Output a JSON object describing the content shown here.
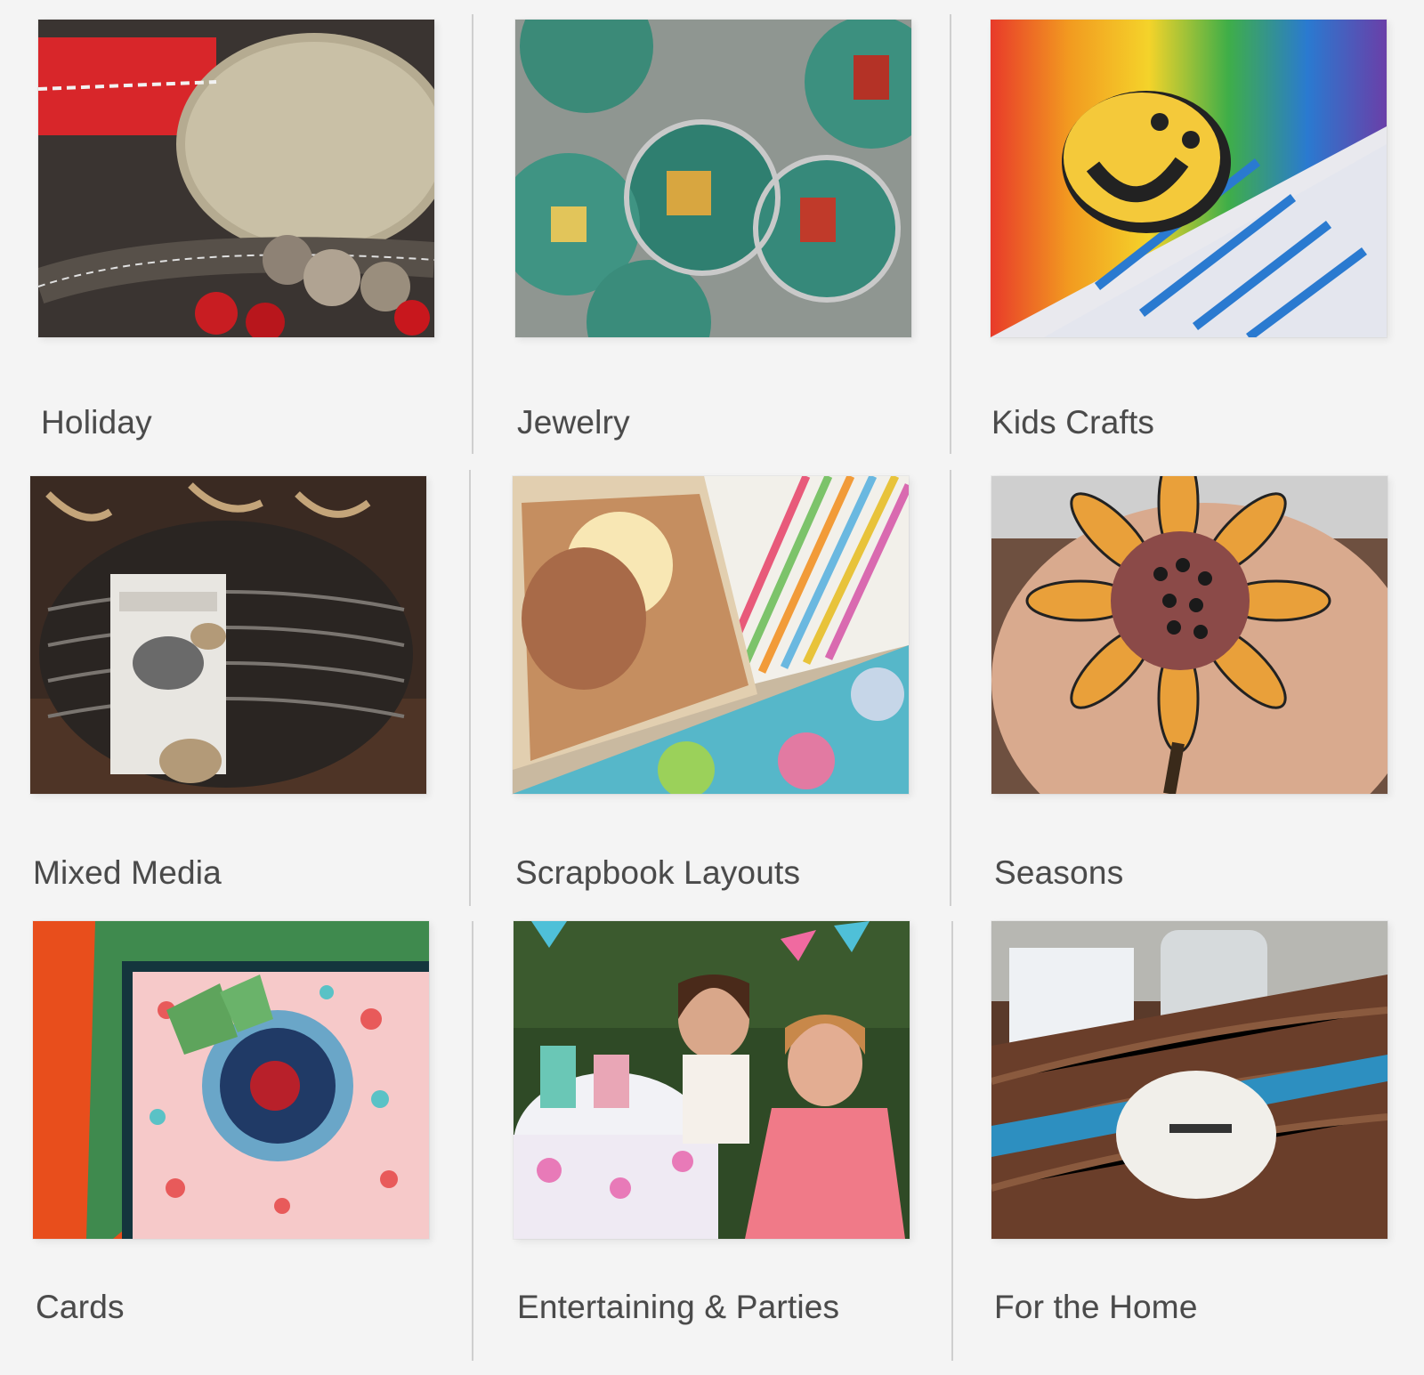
{
  "gallery": {
    "categories": [
      {
        "label": "Holiday",
        "photo": "gift-tag-photo"
      },
      {
        "label": "Jewelry",
        "photo": "bottlecap-necklace-photo"
      },
      {
        "label": "Kids Crafts",
        "photo": "melted-crayon-art-photo"
      },
      {
        "label": "Mixed Media",
        "photo": "basket-with-tags-photo"
      },
      {
        "label": "Scrapbook Layouts",
        "photo": "scrapbook-page-photo"
      },
      {
        "label": "Seasons",
        "photo": "sunflower-art-photo"
      },
      {
        "label": "Cards",
        "photo": "flower-card-photo"
      },
      {
        "label": "Entertaining & Parties",
        "photo": "tea-party-photo"
      },
      {
        "label": "For the Home",
        "photo": "storage-basket-photo"
      }
    ]
  },
  "colors": {
    "background": "#f4f4f4",
    "label_text": "#4a4a4a",
    "divider": "#cfcfcf"
  }
}
